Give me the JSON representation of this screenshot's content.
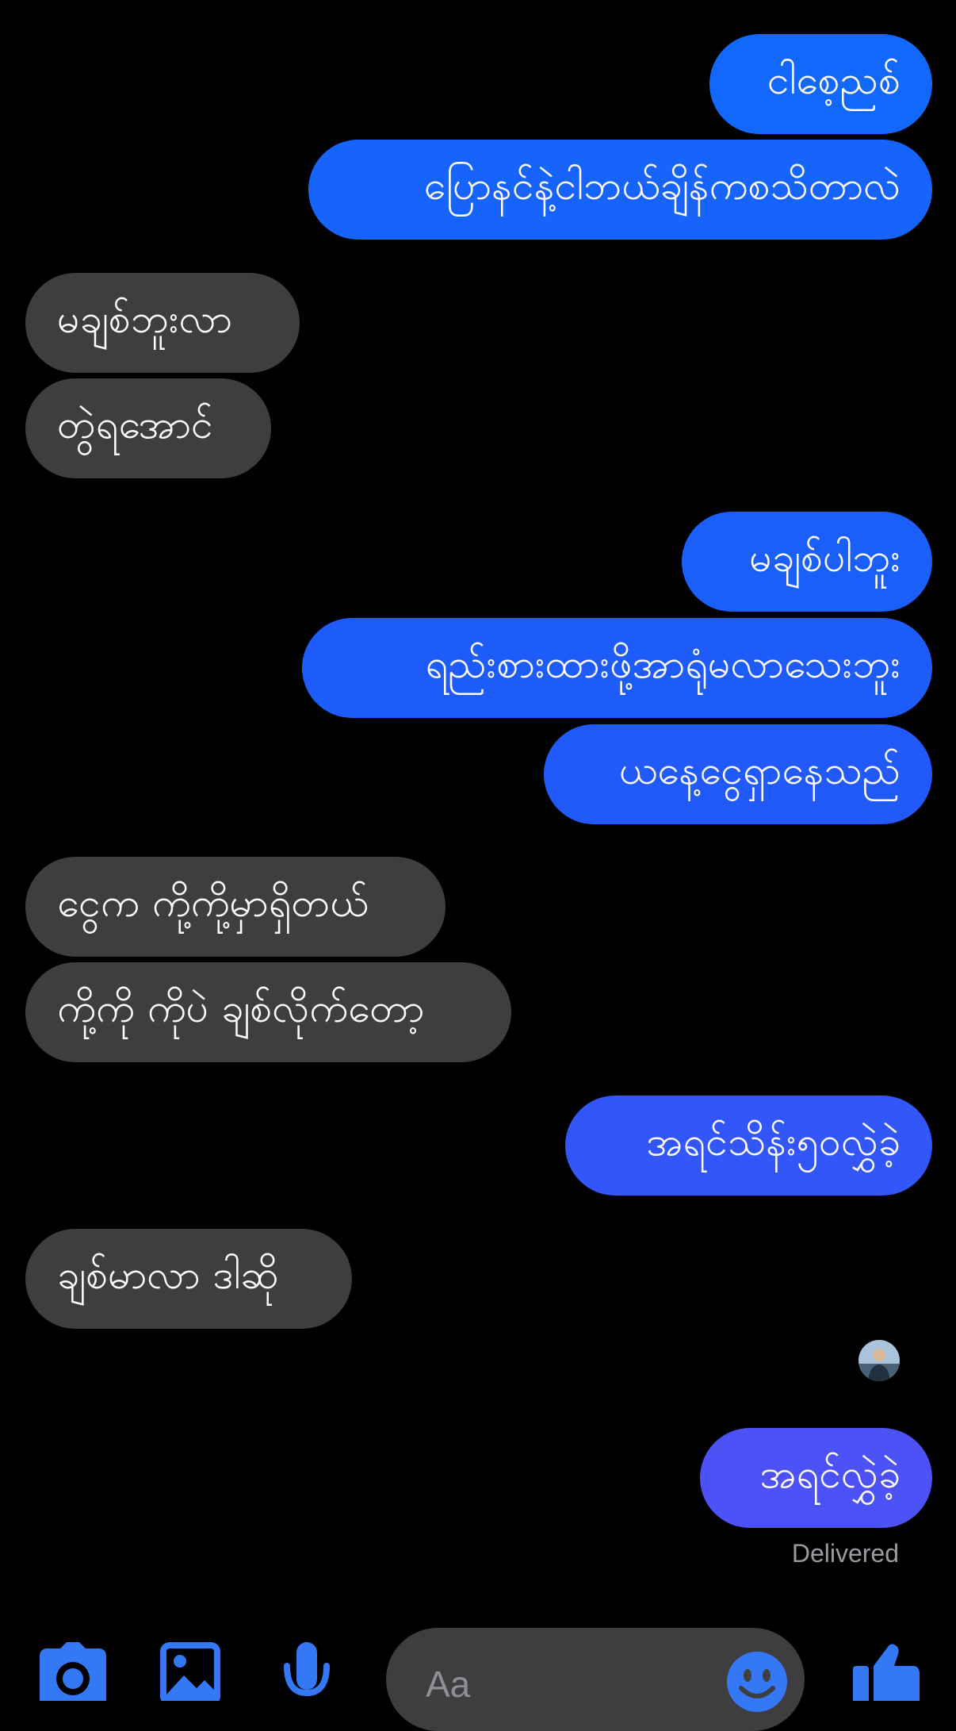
{
  "colors": {
    "background": "#000000",
    "sent_top": "#0a84ff",
    "sent_bottom": "#4c52f5",
    "received": "#3e3e40",
    "accent": "#3478f6"
  },
  "messages": [
    {
      "direction": "sent",
      "text": "ငါစေ့ညစ်"
    },
    {
      "direction": "sent",
      "text": "ပြောနင်နဲ့ငါဘယ်ချိန်ကစသိတာလဲ"
    },
    {
      "direction": "received",
      "text": "မချစ်ဘူးလာ"
    },
    {
      "direction": "received",
      "text": "တွဲရအောင်"
    },
    {
      "direction": "sent",
      "text": "မချစ်ပါဘူး"
    },
    {
      "direction": "sent",
      "text": "ရည်းစားထားဖို့အာရုံမလာသေးဘူး"
    },
    {
      "direction": "sent",
      "text": "ယနေ့ငွေရှာနေသည်"
    },
    {
      "direction": "received",
      "text": "ငွေက ကို့ကို့မှာရှိတယ်"
    },
    {
      "direction": "received",
      "text": "ကို့ကို ကိုပဲ ချစ်လိုက်တော့"
    },
    {
      "direction": "sent",
      "text": "အရင်သိန်း၅၀လွှဲခဲ့"
    },
    {
      "direction": "received",
      "text": "ချစ်မာလာ ဒါဆို"
    },
    {
      "direction": "sent",
      "text": "အရင်လွှဲခဲ့"
    }
  ],
  "status": {
    "delivered": "Delivered"
  },
  "composer": {
    "placeholder": "Aa"
  },
  "toolbar": {
    "icons": [
      "camera-icon",
      "image-icon",
      "microphone-icon",
      "emoji-icon",
      "thumbs-up-icon"
    ]
  }
}
